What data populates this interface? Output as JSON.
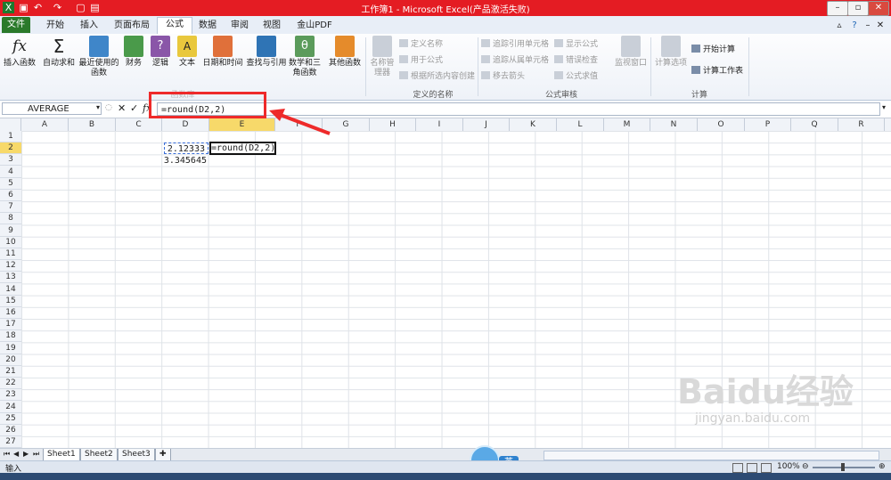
{
  "title_bar": {
    "title": "工作簿1 - Microsoft Excel(产品激活失败)"
  },
  "tabs": [
    "文件",
    "开始",
    "插入",
    "页面布局",
    "公式",
    "数据",
    "审阅",
    "视图",
    "金山PDF"
  ],
  "active_tab": "公式",
  "ribbon": {
    "function_library": [
      {
        "label": "插入函数",
        "icon": "fx-icon"
      },
      {
        "label": "自动求和",
        "icon": "sigma-icon"
      },
      {
        "label": "最近使用的函数",
        "icon": "book-blue-icon"
      },
      {
        "label": "财务",
        "icon": "book-green-icon"
      },
      {
        "label": "逻辑",
        "icon": "book-question-icon"
      },
      {
        "label": "文本",
        "icon": "book-a-icon"
      },
      {
        "label": "日期和时间",
        "icon": "book-clock-icon"
      },
      {
        "label": "查找与引用",
        "icon": "book-search-icon"
      },
      {
        "label": "数学和三角函数",
        "icon": "book-theta-icon"
      },
      {
        "label": "其他函数",
        "icon": "books-icon"
      }
    ],
    "defined_names": {
      "manager": "名称管理器",
      "items": [
        "定义名称",
        "用于公式",
        "根据所选内容创建"
      ],
      "group_label": "定义的名称"
    },
    "formula_auditing": {
      "items": [
        "追踪引用单元格",
        "追踪从属单元格",
        "移去箭头",
        "显示公式",
        "错误检查",
        "公式求值"
      ],
      "watch": "监视窗口",
      "group_label": "公式审核"
    },
    "calculation": {
      "options": "计算选项",
      "items": [
        "开始计算",
        "计算工作表"
      ],
      "group_label": "计算"
    },
    "function_group_label": "函数库"
  },
  "formula_bar": {
    "name_box": "AVERAGE",
    "fx_label": "fx",
    "formula": "=round(D2,2)"
  },
  "columns": [
    "A",
    "B",
    "C",
    "D",
    "E",
    "F",
    "G",
    "H",
    "I",
    "J",
    "K",
    "L",
    "M",
    "N",
    "O",
    "P",
    "Q",
    "R"
  ],
  "active_column": "E",
  "rows": [
    "1",
    "2",
    "3",
    "4",
    "5",
    "6",
    "7",
    "8",
    "9",
    "10",
    "11",
    "12",
    "13",
    "14",
    "15",
    "16",
    "17",
    "18",
    "19",
    "20",
    "21",
    "22",
    "23",
    "24",
    "25",
    "26",
    "27"
  ],
  "active_row": "2",
  "cells": {
    "D2": "2.12333",
    "D3": "3.345645",
    "E2": "=round(D2,2)"
  },
  "sheets": [
    "Sheet1",
    "Sheet2",
    "Sheet3"
  ],
  "active_sheet": "Sheet1",
  "status_bar": {
    "mode": "输入",
    "zoom": "100%"
  },
  "ime": "英",
  "watermark": {
    "brand": "Baidu经验",
    "url": "jingyan.baidu.com"
  }
}
